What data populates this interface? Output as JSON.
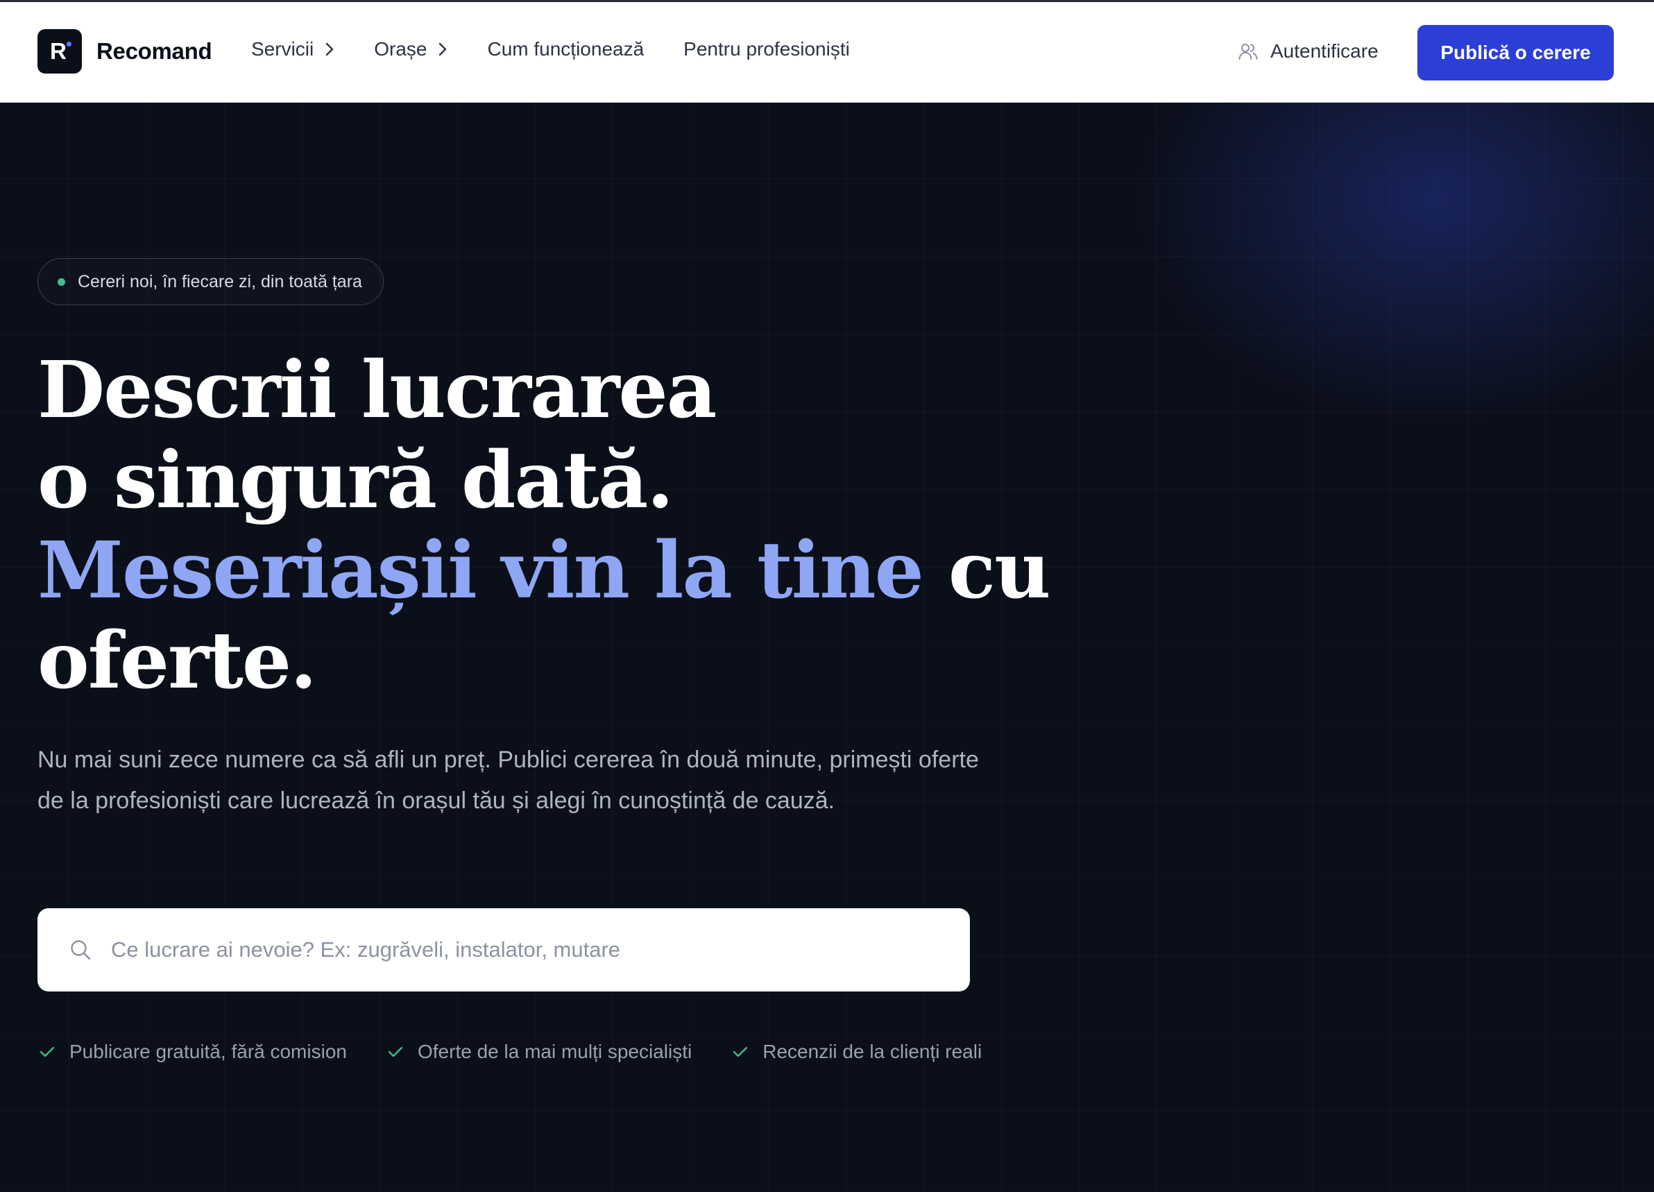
{
  "brand": {
    "logo_letter": "R",
    "name": "Recomand"
  },
  "nav": {
    "items": [
      {
        "label": "Servicii",
        "has_chevron": true
      },
      {
        "label": "Orașe",
        "has_chevron": true
      },
      {
        "label": "Cum funcționează",
        "has_chevron": false
      },
      {
        "label": "Pentru profesioniști",
        "has_chevron": false
      }
    ],
    "login_label": "Autentificare",
    "login_icon": "users-icon",
    "cta_label": "Publică o cerere"
  },
  "hero": {
    "badge": "Cereri noi, în fiecare zi, din toată țara",
    "headline": {
      "line1": "Descrii lucrarea",
      "line2": "o singură dată.",
      "line3_accent": "Meseriașii vin la tine",
      "line3_rest": " cu",
      "line4": "oferte."
    },
    "subtitle": "Nu mai suni zece numere ca să afli un preț. Publici cererea în două minute, primești oferte de la profesioniști care lucrează în orașul tău și alegi în cunoștință de cauză.",
    "search": {
      "icon": "search-icon",
      "placeholder": "Ce lucrare ai nevoie? Ex: zugrăveli, instalator, mutare",
      "value": ""
    },
    "features": [
      "Publicare gratuită, fără comision",
      "Oferte de la mai mulți specialiști",
      "Recenzii de la clienți reali"
    ]
  },
  "colors": {
    "background": "#0b0f1a",
    "accent_blue": "#2b3fd6",
    "headline_accent": "#8ea6f3",
    "badge_dot": "#3fbf8a",
    "check": "#3fbf8a"
  }
}
